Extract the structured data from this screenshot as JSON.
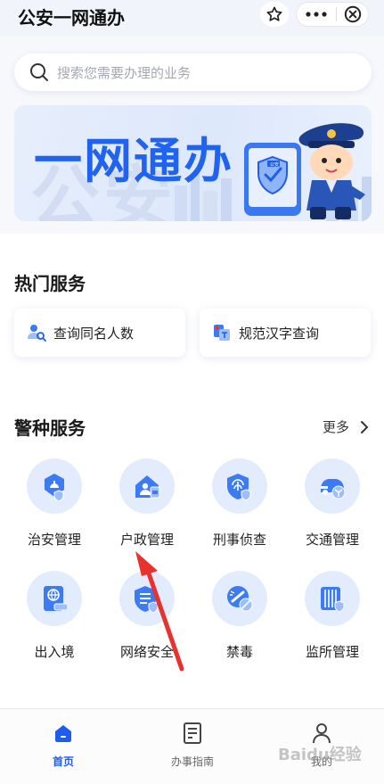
{
  "header": {
    "title": "公安一网通办"
  },
  "search": {
    "placeholder": "搜索您需要办理的业务"
  },
  "banner": {
    "title": "一网通办",
    "background_text": "公安",
    "phone_badge": "公安"
  },
  "hot_services": {
    "title": "热门服务",
    "items": [
      {
        "label": "查询同名人数",
        "icon": "people-search-icon"
      },
      {
        "label": "规范汉字查询",
        "icon": "chinese-character-icon"
      }
    ]
  },
  "police_services": {
    "title": "警种服务",
    "more_label": "更多",
    "items": [
      {
        "label": "治安管理",
        "icon": "public-security-icon"
      },
      {
        "label": "户政管理",
        "icon": "household-registration-icon"
      },
      {
        "label": "刑事侦查",
        "icon": "criminal-investigation-icon"
      },
      {
        "label": "交通管理",
        "icon": "traffic-management-icon"
      },
      {
        "label": "出入境",
        "icon": "passport-icon"
      },
      {
        "label": "网络安全",
        "icon": "cyber-security-icon"
      },
      {
        "label": "禁毒",
        "icon": "anti-drug-icon"
      },
      {
        "label": "监所管理",
        "icon": "detention-management-icon"
      }
    ]
  },
  "tabbar": {
    "items": [
      {
        "label": "首页",
        "icon": "home-icon",
        "active": true
      },
      {
        "label": "办事指南",
        "icon": "guide-icon",
        "active": false
      },
      {
        "label": "我的",
        "icon": "profile-icon",
        "active": false
      }
    ]
  },
  "watermark": {
    "text": "Baidu经验"
  },
  "colors": {
    "accent": "#1e5cf0",
    "icon_bg": "#e3ecfd",
    "annotation_arrow": "#e8322e"
  }
}
